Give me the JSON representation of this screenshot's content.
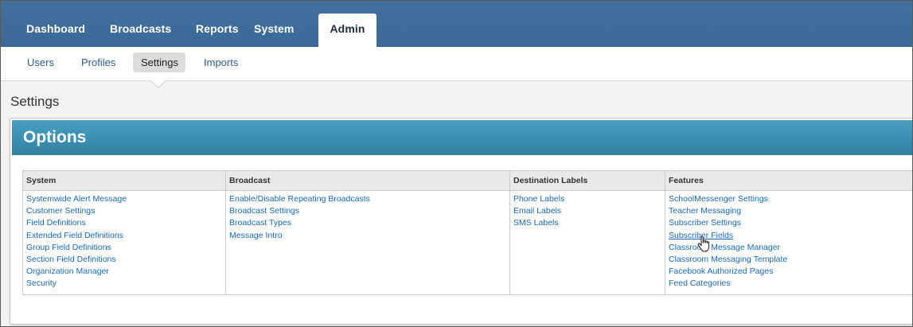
{
  "topnav": {
    "tabs": [
      {
        "label": "Dashboard"
      },
      {
        "label": "Broadcasts"
      },
      {
        "label": "Reports"
      },
      {
        "label": "System"
      },
      {
        "label": "Admin",
        "active": true
      }
    ]
  },
  "subnav": {
    "items": [
      {
        "label": "Users"
      },
      {
        "label": "Profiles"
      },
      {
        "label": "Settings",
        "active": true
      },
      {
        "label": "Imports"
      }
    ]
  },
  "page": {
    "title": "Settings"
  },
  "panel": {
    "title": "Options",
    "columns": [
      {
        "header": "System",
        "links": [
          "Systemwide Alert Message",
          "Customer Settings",
          "Field Definitions",
          "Extended Field Definitions",
          "Group Field Definitions",
          "Section Field Definitions",
          "Organization Manager",
          "Security"
        ]
      },
      {
        "header": "Broadcast",
        "links": [
          "Enable/Disable Repeating Broadcasts",
          "Broadcast Settings",
          "Broadcast Types",
          "Message Intro"
        ]
      },
      {
        "header": "Destination Labels",
        "links": [
          "Phone Labels",
          "Email Labels",
          "SMS Labels"
        ]
      },
      {
        "header": "Features",
        "links": [
          "SchoolMessenger Settings",
          "Teacher Messaging",
          "Subscriber Settings",
          "Subscriber Fields",
          "Classroom Message Manager",
          "Classroom Messaging Template",
          "Facebook Authorized Pages",
          "Feed Categories"
        ]
      }
    ]
  },
  "colors": {
    "nav_bg": "#3e6d9c",
    "panel_header": "#3b8fb1",
    "link": "#1a69b5"
  },
  "cursor": {
    "icon": "hand-pointer-icon"
  }
}
